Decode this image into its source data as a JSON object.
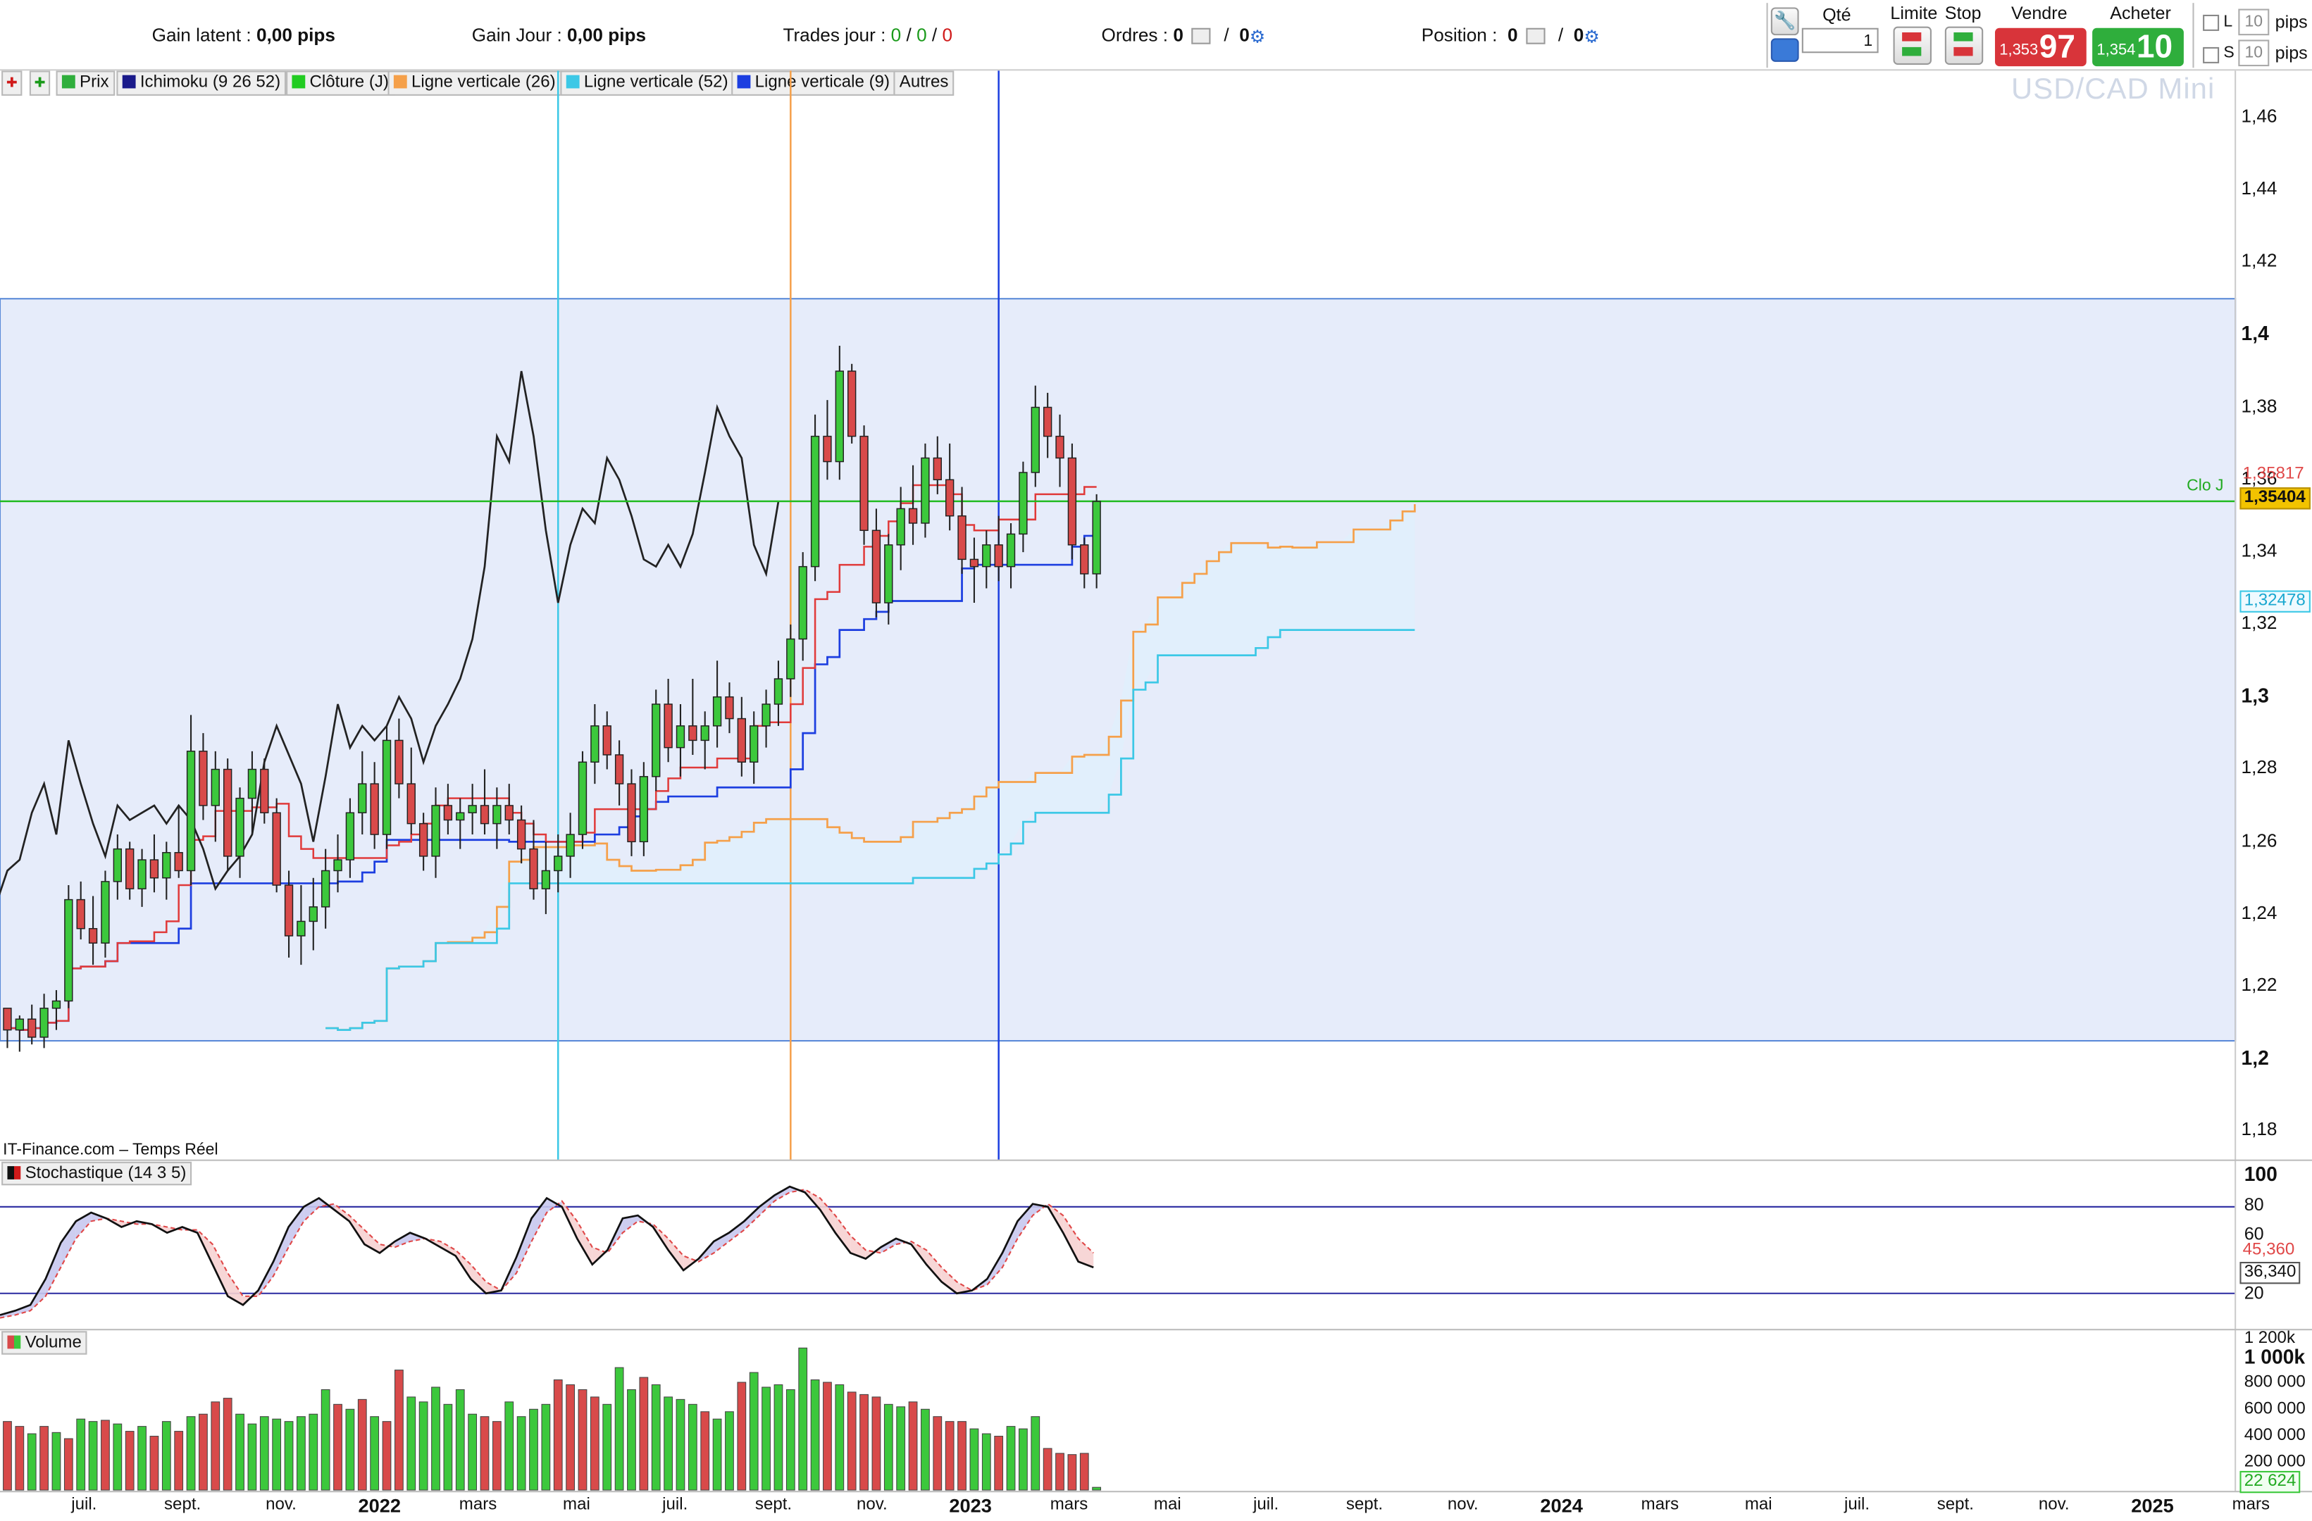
{
  "topbar": {
    "gain_latent": {
      "label": "Gain latent :",
      "value": "0,00 pips"
    },
    "gain_jour": {
      "label": "Gain Jour :",
      "value": "0,00 pips"
    },
    "trades_jour": {
      "label": "Trades jour :",
      "v1": "0",
      "v2": "0",
      "v3": "0",
      "sep": "/"
    },
    "ordres": {
      "label": "Ordres :",
      "v1": "0",
      "v2": "0",
      "sep": "/"
    },
    "position": {
      "label": "Position :",
      "v1": "0",
      "v2": "0",
      "sep": "/"
    }
  },
  "trade_panel": {
    "qte_label": "Qté",
    "qte_value": "1",
    "limite_label": "Limite",
    "stop_label": "Stop",
    "vendre_label": "Vendre",
    "acheter_label": "Acheter",
    "sell_small": "1,353",
    "sell_big": "97",
    "buy_small": "1,354",
    "buy_big": "10",
    "l_label": "L",
    "s_label": "S",
    "l_value": "10",
    "s_value": "10",
    "pips_label": "pips"
  },
  "legend_tabs": [
    {
      "label": "Prix",
      "color": "#2fae3c"
    },
    {
      "label": "Ichimoku (9 26 52)",
      "color": "#1a1a8a"
    },
    {
      "label": "Clôture (J)",
      "color": "#22cc22"
    },
    {
      "label": "Ligne verticale (26)",
      "color": "#f5a04a"
    },
    {
      "label": "Ligne verticale (52)",
      "color": "#3cc8e6"
    },
    {
      "label": "Ligne verticale (9)",
      "color": "#1c3ee0"
    },
    {
      "label": "Autres",
      "color": ""
    }
  ],
  "watermark": "USD/CAD Mini",
  "source_label": "IT-Finance.com – Temps Réel",
  "clo_label": "Clo J",
  "price_tags": {
    "red": "1,35817",
    "close": "1,35404",
    "cyan": "1,32478"
  },
  "colors": {
    "bull": "#3cc83c",
    "bear": "#d84a4a",
    "tenkan": "#e03a3a",
    "kijun": "#1c3ee0",
    "chikou": "#222222",
    "ssa": "#f5a04a",
    "ssb": "#3cc8e6",
    "close_line": "#22bb22",
    "band": "#e6ecfa"
  },
  "stoch_label": "Stochastique (14 3 5)",
  "stoch_tags": {
    "d": "45,360",
    "k": "36,340"
  },
  "stoch_axis": [
    "100",
    "80",
    "60",
    "20"
  ],
  "volume_label": "Volume",
  "volume_axis": [
    "1 200k",
    "1 000k",
    "800 000",
    "600 000",
    "400 000",
    "200 000"
  ],
  "volume_tag": "22 624",
  "chart_data": [
    {
      "type": "candlestick",
      "title": "USD/CAD Mini",
      "yticks": [
        1.18,
        1.2,
        1.22,
        1.24,
        1.26,
        1.28,
        1.3,
        1.32,
        1.34,
        1.36,
        1.38,
        1.4,
        1.42,
        1.44,
        1.46
      ],
      "ytick_labels": [
        "1,18",
        "1,2",
        "1,22",
        "1,24",
        "1,26",
        "1,28",
        "1,3",
        "1,32",
        "1,34",
        "1,36",
        "1,38",
        "1,4",
        "1,42",
        "1,44",
        "1,46"
      ],
      "ylim": [
        1.172,
        1.473
      ],
      "xticks": [
        {
          "label": "juil.",
          "bold": false
        },
        {
          "label": "sept.",
          "bold": false
        },
        {
          "label": "nov.",
          "bold": false
        },
        {
          "label": "2022",
          "bold": true
        },
        {
          "label": "mars",
          "bold": false
        },
        {
          "label": "mai",
          "bold": false
        },
        {
          "label": "juil.",
          "bold": false
        },
        {
          "label": "sept.",
          "bold": false
        },
        {
          "label": "nov.",
          "bold": false
        },
        {
          "label": "2023",
          "bold": true
        },
        {
          "label": "mars",
          "bold": false
        },
        {
          "label": "mai",
          "bold": false
        },
        {
          "label": "juil.",
          "bold": false
        },
        {
          "label": "sept.",
          "bold": false
        },
        {
          "label": "nov.",
          "bold": false
        },
        {
          "label": "2024",
          "bold": true
        },
        {
          "label": "mars",
          "bold": false
        },
        {
          "label": "mai",
          "bold": false
        },
        {
          "label": "juil.",
          "bold": false
        },
        {
          "label": "sept.",
          "bold": false
        },
        {
          "label": "nov.",
          "bold": false
        },
        {
          "label": "2025",
          "bold": true
        },
        {
          "label": "mars",
          "bold": false
        }
      ],
      "close_level": 1.35404,
      "band_range": [
        1.205,
        1.41
      ],
      "candles_ohlc": [
        [
          1.214,
          1.214,
          1.203,
          1.208
        ],
        [
          1.208,
          1.212,
          1.202,
          1.211
        ],
        [
          1.211,
          1.215,
          1.204,
          1.206
        ],
        [
          1.206,
          1.218,
          1.203,
          1.214
        ],
        [
          1.214,
          1.219,
          1.208,
          1.216
        ],
        [
          1.216,
          1.248,
          1.214,
          1.244
        ],
        [
          1.244,
          1.249,
          1.233,
          1.236
        ],
        [
          1.236,
          1.245,
          1.226,
          1.232
        ],
        [
          1.232,
          1.252,
          1.228,
          1.249
        ],
        [
          1.249,
          1.262,
          1.244,
          1.258
        ],
        [
          1.258,
          1.26,
          1.244,
          1.247
        ],
        [
          1.247,
          1.258,
          1.242,
          1.255
        ],
        [
          1.255,
          1.262,
          1.246,
          1.25
        ],
        [
          1.25,
          1.26,
          1.244,
          1.257
        ],
        [
          1.257,
          1.27,
          1.25,
          1.252
        ],
        [
          1.252,
          1.295,
          1.248,
          1.285
        ],
        [
          1.285,
          1.29,
          1.266,
          1.27
        ],
        [
          1.27,
          1.285,
          1.26,
          1.28
        ],
        [
          1.28,
          1.283,
          1.252,
          1.256
        ],
        [
          1.256,
          1.275,
          1.25,
          1.272
        ],
        [
          1.272,
          1.285,
          1.262,
          1.28
        ],
        [
          1.28,
          1.283,
          1.265,
          1.268
        ],
        [
          1.268,
          1.272,
          1.246,
          1.248
        ],
        [
          1.248,
          1.252,
          1.228,
          1.234
        ],
        [
          1.234,
          1.248,
          1.226,
          1.238
        ],
        [
          1.238,
          1.25,
          1.23,
          1.242
        ],
        [
          1.242,
          1.258,
          1.236,
          1.252
        ],
        [
          1.252,
          1.262,
          1.246,
          1.255
        ],
        [
          1.255,
          1.272,
          1.25,
          1.268
        ],
        [
          1.268,
          1.285,
          1.262,
          1.276
        ],
        [
          1.276,
          1.282,
          1.258,
          1.262
        ],
        [
          1.262,
          1.292,
          1.258,
          1.288
        ],
        [
          1.288,
          1.294,
          1.272,
          1.276
        ],
        [
          1.276,
          1.286,
          1.262,
          1.265
        ],
        [
          1.265,
          1.268,
          1.252,
          1.256
        ],
        [
          1.256,
          1.275,
          1.25,
          1.27
        ],
        [
          1.27,
          1.276,
          1.262,
          1.266
        ],
        [
          1.266,
          1.272,
          1.258,
          1.268
        ],
        [
          1.268,
          1.276,
          1.262,
          1.27
        ],
        [
          1.27,
          1.28,
          1.262,
          1.265
        ],
        [
          1.265,
          1.275,
          1.258,
          1.27
        ],
        [
          1.27,
          1.276,
          1.262,
          1.266
        ],
        [
          1.266,
          1.27,
          1.254,
          1.258
        ],
        [
          1.258,
          1.266,
          1.244,
          1.247
        ],
        [
          1.247,
          1.26,
          1.24,
          1.252
        ],
        [
          1.252,
          1.262,
          1.246,
          1.256
        ],
        [
          1.256,
          1.268,
          1.25,
          1.262
        ],
        [
          1.262,
          1.285,
          1.258,
          1.282
        ],
        [
          1.282,
          1.298,
          1.276,
          1.292
        ],
        [
          1.292,
          1.296,
          1.28,
          1.284
        ],
        [
          1.284,
          1.288,
          1.27,
          1.276
        ],
        [
          1.276,
          1.28,
          1.256,
          1.26
        ],
        [
          1.26,
          1.282,
          1.256,
          1.278
        ],
        [
          1.278,
          1.302,
          1.274,
          1.298
        ],
        [
          1.298,
          1.305,
          1.282,
          1.286
        ],
        [
          1.286,
          1.298,
          1.278,
          1.292
        ],
        [
          1.292,
          1.305,
          1.284,
          1.288
        ],
        [
          1.288,
          1.296,
          1.28,
          1.292
        ],
        [
          1.292,
          1.31,
          1.286,
          1.3
        ],
        [
          1.3,
          1.304,
          1.29,
          1.294
        ],
        [
          1.294,
          1.3,
          1.278,
          1.282
        ],
        [
          1.282,
          1.296,
          1.276,
          1.292
        ],
        [
          1.292,
          1.302,
          1.286,
          1.298
        ],
        [
          1.298,
          1.31,
          1.292,
          1.305
        ],
        [
          1.305,
          1.32,
          1.3,
          1.316
        ],
        [
          1.316,
          1.34,
          1.31,
          1.336
        ],
        [
          1.336,
          1.378,
          1.332,
          1.372
        ],
        [
          1.372,
          1.382,
          1.36,
          1.365
        ],
        [
          1.365,
          1.397,
          1.36,
          1.39
        ],
        [
          1.39,
          1.392,
          1.37,
          1.372
        ],
        [
          1.372,
          1.375,
          1.342,
          1.346
        ],
        [
          1.346,
          1.352,
          1.322,
          1.326
        ],
        [
          1.326,
          1.345,
          1.32,
          1.342
        ],
        [
          1.342,
          1.358,
          1.335,
          1.352
        ],
        [
          1.352,
          1.364,
          1.342,
          1.348
        ],
        [
          1.348,
          1.37,
          1.344,
          1.366
        ],
        [
          1.366,
          1.372,
          1.356,
          1.36
        ],
        [
          1.36,
          1.37,
          1.346,
          1.35
        ],
        [
          1.35,
          1.358,
          1.334,
          1.338
        ],
        [
          1.338,
          1.344,
          1.326,
          1.336
        ],
        [
          1.336,
          1.346,
          1.33,
          1.342
        ],
        [
          1.342,
          1.35,
          1.332,
          1.336
        ],
        [
          1.336,
          1.348,
          1.33,
          1.345
        ],
        [
          1.345,
          1.365,
          1.34,
          1.362
        ],
        [
          1.362,
          1.386,
          1.358,
          1.38
        ],
        [
          1.38,
          1.384,
          1.366,
          1.372
        ],
        [
          1.372,
          1.378,
          1.358,
          1.366
        ],
        [
          1.366,
          1.37,
          1.338,
          1.342
        ],
        [
          1.342,
          1.344,
          1.33,
          1.334
        ],
        [
          1.334,
          1.356,
          1.33,
          1.354
        ]
      ],
      "x_start_bar": 0,
      "bars_per_month": 4.35
    },
    {
      "type": "line",
      "title": "Stochastique (14 3 5)",
      "ylim": [
        0,
        100
      ],
      "levels": [
        80,
        20
      ],
      "series": [
        {
          "name": "%K",
          "values": [
            5,
            8,
            12,
            30,
            55,
            70,
            76,
            72,
            66,
            70,
            68,
            62,
            66,
            62,
            40,
            18,
            12,
            22,
            42,
            66,
            80,
            86,
            78,
            70,
            54,
            48,
            56,
            62,
            58,
            52,
            46,
            30,
            20,
            22,
            45,
            72,
            86,
            80,
            58,
            40,
            50,
            72,
            74,
            66,
            50,
            36,
            44,
            56,
            62,
            70,
            80,
            88,
            94,
            90,
            78,
            62,
            48,
            44,
            52,
            58,
            54,
            40,
            28,
            20,
            22,
            30,
            48,
            70,
            82,
            80,
            62,
            42,
            38
          ]
        },
        {
          "name": "%D",
          "values": [
            3,
            5,
            8,
            18,
            38,
            58,
            70,
            72,
            70,
            68,
            68,
            66,
            64,
            64,
            54,
            34,
            18,
            18,
            32,
            52,
            70,
            80,
            82,
            74,
            64,
            54,
            52,
            56,
            58,
            56,
            50,
            40,
            28,
            22,
            34,
            56,
            76,
            84,
            70,
            52,
            48,
            62,
            70,
            68,
            58,
            46,
            42,
            48,
            56,
            64,
            74,
            84,
            90,
            92,
            86,
            74,
            60,
            50,
            48,
            54,
            56,
            50,
            38,
            28,
            22,
            26,
            38,
            58,
            74,
            82,
            74,
            58,
            48
          ]
        }
      ]
    },
    {
      "type": "bar",
      "title": "Volume",
      "ylim": [
        0,
        1250000
      ],
      "values": [
        560000,
        520000,
        460000,
        520000,
        470000,
        420000,
        580000,
        560000,
        570000,
        540000,
        480000,
        520000,
        440000,
        560000,
        480000,
        600000,
        620000,
        720000,
        750000,
        620000,
        540000,
        600000,
        580000,
        560000,
        600000,
        620000,
        820000,
        700000,
        660000,
        740000,
        600000,
        560000,
        980000,
        760000,
        720000,
        840000,
        700000,
        820000,
        620000,
        600000,
        560000,
        720000,
        600000,
        660000,
        700000,
        900000,
        860000,
        820000,
        760000,
        700000,
        1000000,
        820000,
        920000,
        860000,
        760000,
        740000,
        700000,
        640000,
        580000,
        640000,
        880000,
        960000,
        840000,
        860000,
        820000,
        1160000,
        900000,
        880000,
        860000,
        800000,
        780000,
        760000,
        700000,
        680000,
        720000,
        660000,
        600000,
        560000,
        560000,
        500000,
        460000,
        440000,
        520000,
        500000,
        600000,
        340000,
        300000,
        290000,
        300000,
        22624
      ],
      "colors_bull_bear": [
        "r",
        "r",
        "g",
        "r",
        "g",
        "r",
        "g",
        "g",
        "r",
        "g",
        "r",
        "g",
        "r",
        "g",
        "r",
        "g",
        "r",
        "r",
        "r",
        "g",
        "g",
        "g",
        "g",
        "g",
        "g",
        "g",
        "g",
        "r",
        "g",
        "r",
        "g",
        "r",
        "r",
        "g",
        "g",
        "g",
        "g",
        "g",
        "g",
        "r",
        "r",
        "g",
        "g",
        "g",
        "g",
        "r",
        "r",
        "r",
        "r",
        "g",
        "g",
        "g",
        "r",
        "g",
        "g",
        "g",
        "g",
        "r",
        "g",
        "g",
        "r",
        "g",
        "g",
        "g",
        "g",
        "g",
        "g",
        "r",
        "g",
        "r",
        "r",
        "r",
        "g",
        "g",
        "r",
        "g",
        "r",
        "r",
        "r",
        "g",
        "g",
        "r",
        "g",
        "g",
        "g",
        "r",
        "r",
        "r",
        "r",
        "g"
      ]
    }
  ]
}
